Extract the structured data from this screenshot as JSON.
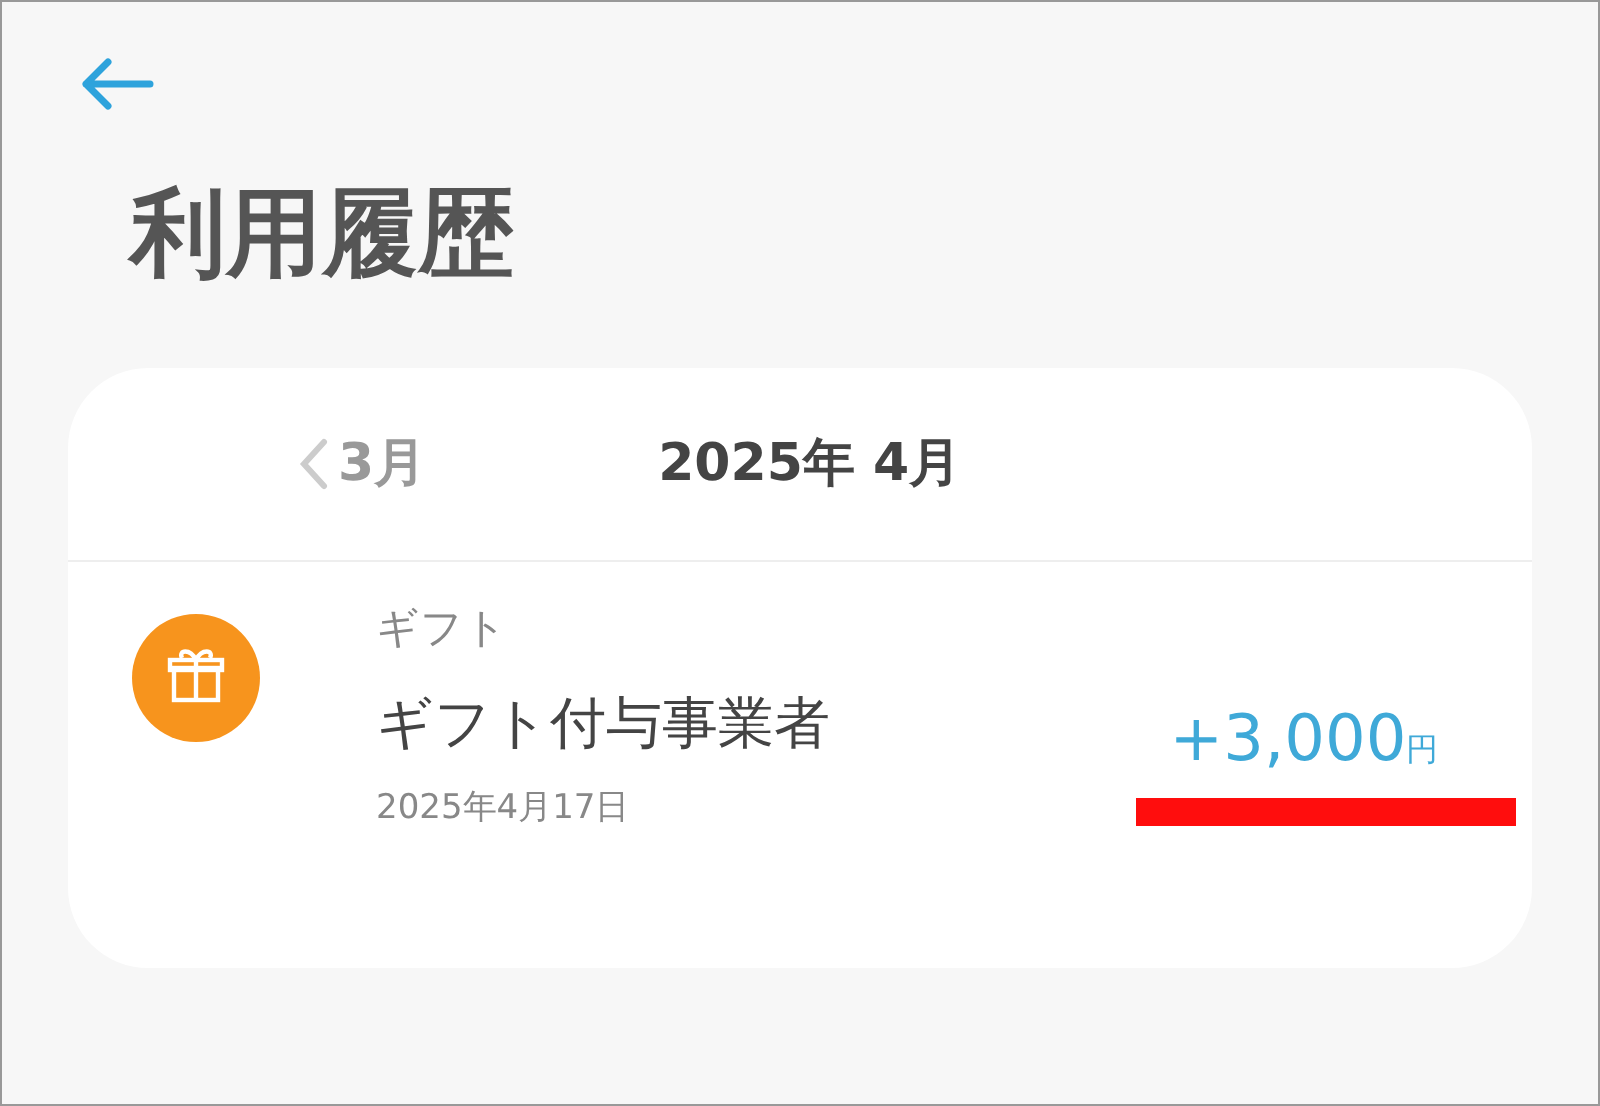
{
  "title": "利用履歴",
  "month_nav": {
    "previous": "3月",
    "current": "2025年 4月"
  },
  "transactions": [
    {
      "category": "ギフト",
      "name": "ギフト付与事業者",
      "date": "2025年4月17日",
      "amount": "+3,000",
      "unit": "円",
      "highlighted": true
    }
  ]
}
